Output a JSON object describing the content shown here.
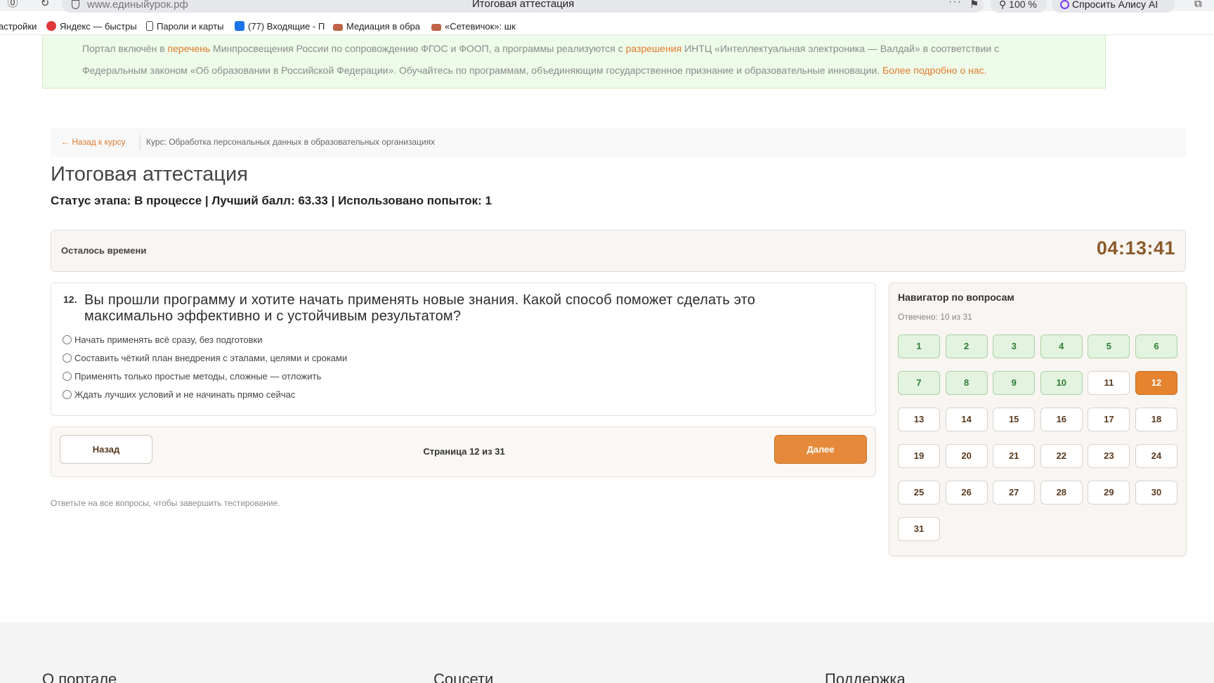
{
  "browser": {
    "url": "www.единыйурок.рф",
    "tab_title": "Итоговая аттестация",
    "dots": "···",
    "zoom": "100 %",
    "alice_label": "Спросить Алису AI",
    "bookmarks": [
      {
        "label": "астройки",
        "color": ""
      },
      {
        "label": "Яндекс — быстры",
        "color": "#e4393c"
      },
      {
        "label": "Пароли и карты",
        "color": ""
      },
      {
        "label": "(77) Входящие - П",
        "color": "#1a73e8"
      },
      {
        "label": "Медиация в обра",
        "color": "#c0634b"
      },
      {
        "label": "«Сетевичок»: шк",
        "color": "#c0634b"
      }
    ]
  },
  "notice": {
    "p1": "Портал включён в ",
    "link1": "перечень",
    "p2": " Минпросвещения России по сопровождению ФГОС и ФООП, а программы реализуются с ",
    "link2": "разрешения",
    "p3": " ИНТЦ «Интеллектуальная электроника — Валдай» в соответствии с Федеральным законом «Об образовании в Российской Федерации». Обучайтесь по программам, объединяющим государственное признание и образовательные инновации. ",
    "link3": "Более подробно о нас."
  },
  "breadcrumb": {
    "back": "← Назад к курсу",
    "course": "Курс: Обработка персональных данных в образовательных организациях"
  },
  "title": "Итоговая аттестация",
  "status_line": "Статус этапа: В процессе | Лучший балл: 63.33 | Использовано попыток: 1",
  "timer": {
    "label": "Осталось времени",
    "value": "04:13:41"
  },
  "question": {
    "number": "12.",
    "text": "Вы прошли программу и хотите начать применять новые знания. Какой способ поможет сделать это максимально эффективно и с устойчивым результатом?",
    "options": [
      "Начать применять всё сразу, без подготовки",
      "Составить чёткий план внедрения с этапами, целями и сроками",
      "Применять только простые методы, сложные — отложить",
      "Ждать лучших условий и не начинать прямо сейчас"
    ]
  },
  "pager": {
    "back": "Назад",
    "info": "Страница 12 из 31",
    "next": "Далее"
  },
  "hint": "Ответьте на все вопросы, чтобы завершить тестирование.",
  "navigator": {
    "title": "Навигатор по вопросам",
    "answered": "Отвечено: 10 из 31",
    "current": 12,
    "answered_numbers": [
      1,
      2,
      3,
      4,
      5,
      6,
      7,
      8,
      9,
      10
    ],
    "total": 31
  },
  "footer": {
    "col1": "О портале",
    "col2": "Соцсети",
    "col3": "Поддержка"
  }
}
